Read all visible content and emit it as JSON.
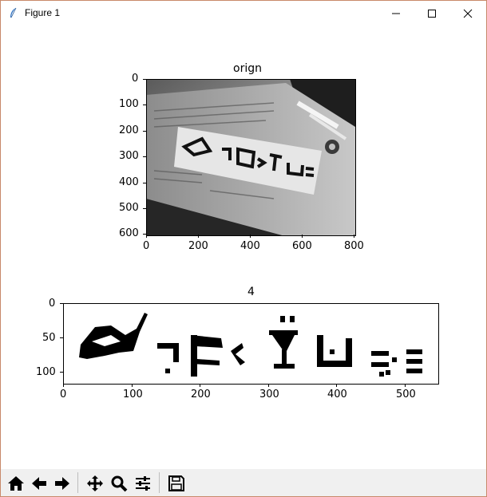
{
  "window": {
    "title": "Figure 1",
    "controls": [
      "minimize-icon",
      "maximize-icon",
      "close-icon"
    ]
  },
  "axes_top": {
    "title": "orign",
    "x_ticks": [
      "0",
      "200",
      "400",
      "600",
      "800"
    ],
    "y_ticks": [
      "0",
      "100",
      "200",
      "300",
      "400",
      "500",
      "600"
    ],
    "image_description_icon": "grayscale-photo"
  },
  "axes_bottom": {
    "title": "4",
    "x_ticks": [
      "0",
      "100",
      "200",
      "300",
      "400",
      "500"
    ],
    "y_ticks": [
      "0",
      "50",
      "100"
    ],
    "image_description_icon": "binary-text-image"
  },
  "toolbar": {
    "buttons": [
      "home-icon",
      "back-icon",
      "forward-icon",
      "pan-icon",
      "zoom-icon",
      "configure-subplots-icon",
      "save-icon"
    ]
  },
  "colors": {
    "toolbar_bg": "#f0f0f0",
    "window_border": "#c8896a",
    "axes_edge": "#000000"
  }
}
